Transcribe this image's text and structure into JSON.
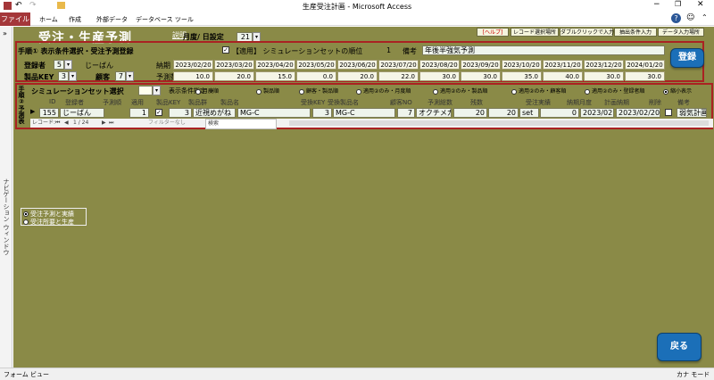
{
  "window": {
    "title": "生産受注計画 - Microsoft Access"
  },
  "ribbon": {
    "tabs": [
      "ファイル",
      "ホーム",
      "作成",
      "外部データ",
      "データベース ツール"
    ],
    "help_icon": "?"
  },
  "nav": {
    "label": "ナビゲーション ウィンドウ",
    "expand": "»"
  },
  "form": {
    "title": "受注・生産予測",
    "help_link": "説明",
    "setting_label": "月度/ 日設定",
    "setting_value": "21",
    "top_buttons": [
      "[ヘルプ]",
      "レコード選択場所",
      "ダブルクリックで入力支援",
      "抽出条件入力",
      "データ入力場所"
    ],
    "step1_label": "手順① 表示条件選択・受注予測登録",
    "step1_note": "*",
    "apply_check_label": "【適用】 シミュレーションセットの順位",
    "apply_value": "1",
    "remarks_label": "備考",
    "remarks_value": "年後半強気予測",
    "registrant_label": "登録者",
    "registrant_value": "5",
    "registrant_name": "じーばん",
    "product_key_label": "製品KEY",
    "product_key_value": "3",
    "customer_label": "顧客",
    "customer_value": "7",
    "delivery_label": "納期",
    "forecast_label": "予測数",
    "delivery_dates": [
      "2023/02/20",
      "2023/03/20",
      "2023/04/20",
      "2023/05/20",
      "2023/06/20",
      "2023/07/20",
      "2023/08/20",
      "2023/09/20",
      "2023/10/20",
      "2023/11/20",
      "2023/12/20",
      "2024/01/20"
    ],
    "forecasts": [
      "10.0",
      "20.0",
      "15.0",
      "0.0",
      "20.0",
      "22.0",
      "30.0",
      "30.0",
      "35.0",
      "40.0",
      "30.0",
      "30.0"
    ],
    "register_button": "登録",
    "step2_label": "手順②予測表",
    "sim_set_label": "シミュレーションセット選択",
    "display_label": "表示条件指定 →",
    "display_options": [
      "月度順",
      "製品順",
      "顧客・製品順",
      "適用②のみ・月度順",
      "適用②のみ・製品順",
      "適用②のみ・顧客順",
      "適用②のみ・登録者順",
      "縮小表示"
    ],
    "columns": [
      "ID",
      "登録者",
      "予測順",
      "適用",
      "製品KEY",
      "製品群",
      "製品名",
      "受換KEY",
      "受換製品名",
      "顧客NO",
      "予測総数",
      "残数",
      "",
      "受注実績",
      "納期月度",
      "計画納期",
      "削除",
      "備考"
    ],
    "row": {
      "id": "155",
      "registrant": "じーばん",
      "order": "1",
      "key": "3",
      "group": "近視めがね",
      "name": "MG-C",
      "conv_key": "3",
      "conv_name": "MG-C",
      "cust": "7",
      "cust_name": "オクチメガネ",
      "total": "20",
      "remain": "20",
      "unit": "set",
      "actual": "0",
      "month": "2023/02",
      "planned": "2023/02/20",
      "note": "弱気計画"
    },
    "nav_record_label": "レコード:",
    "nav_position": "1 / 24",
    "filter_label": "フィルターなし",
    "search_label": "検索",
    "option1": "受注予測と実績",
    "option2": "受注所要と生産",
    "back_button": "戻る"
  },
  "status": {
    "left": "フォーム ビュー",
    "right": "カナ モード"
  }
}
